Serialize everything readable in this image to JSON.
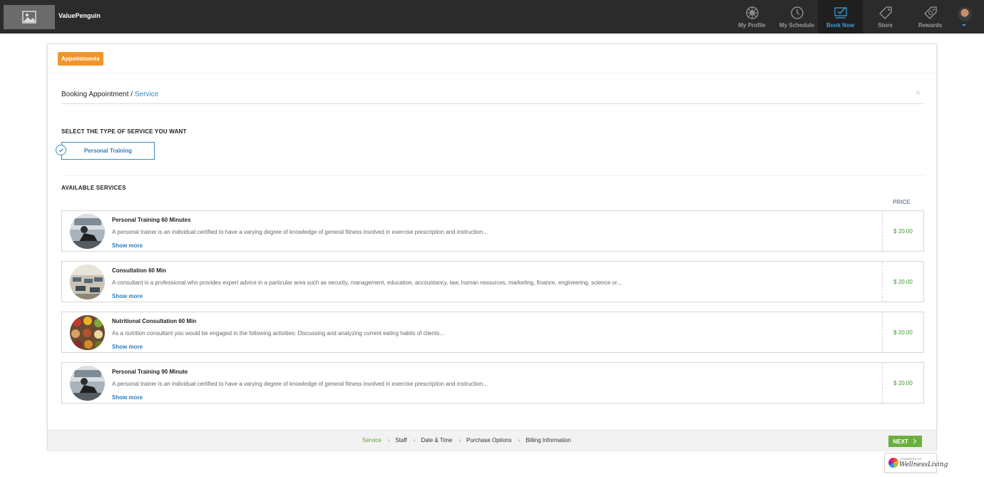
{
  "header": {
    "brand": "ValuePenguin",
    "nav": [
      {
        "label": "My Profile",
        "icon": "dharma-wheel-icon",
        "active": false
      },
      {
        "label": "My Schedule",
        "icon": "clock-icon",
        "active": false
      },
      {
        "label": "Book Now",
        "icon": "book-now-icon",
        "active": true
      },
      {
        "label": "Store",
        "icon": "tag-icon",
        "active": false
      },
      {
        "label": "Rewards",
        "icon": "reward-tag-icon",
        "active": false
      }
    ]
  },
  "card": {
    "tab": "Appointments",
    "breadcrumb": {
      "root": "Booking Appointment",
      "separator": " / ",
      "current": "Service"
    },
    "close": "×",
    "service_type_title": "SELECT THE TYPE OF SERVICE YOU WANT",
    "service_type_selected": "Personal Training",
    "available_title": "AVAILABLE SERVICES",
    "price_header": "PRICE",
    "services": [
      {
        "name": "Personal Training 60 Minutes",
        "description": "A personal trainer is an individual certified to have a varying degree of knowledge of general fitness involved in exercise prescription and instruction...",
        "show_more": "Show more",
        "price": "$ 20.00",
        "thumb": "gym"
      },
      {
        "name": "Consultation 60 Min",
        "description": "A consultant is a professional who provides expert advice in a particular area such as security, management, education, accountancy, law, human resources, marketing, finance, engineering, science or...",
        "show_more": "Show more",
        "price": "$ 20.00",
        "thumb": "gym-floor"
      },
      {
        "name": "Nutritional Consultation 60 Min",
        "description": "As a nutrition consultant you would be engaged in the following activities: Discussing and analyzing current eating habits of clients...",
        "show_more": "Show more",
        "price": "$ 20.00",
        "thumb": "food"
      },
      {
        "name": "Personal Training 90 Minute",
        "description": "A personal trainer is an individual certified to have a varying degree of knowledge of general fitness involved in exercise prescription and instruction...",
        "show_more": "Show more",
        "price": "$ 20.00",
        "thumb": "gym"
      }
    ],
    "steps": [
      "Service",
      "Staff",
      "Date & Time",
      "Purchase Options",
      "Billing Information"
    ],
    "active_step": "Service",
    "next": "NEXT"
  },
  "powered_by": {
    "small": "POWERED BY",
    "name": "WellnessLiving"
  },
  "colors": {
    "accent": "#3b9dd8",
    "tab": "#f0952a",
    "price": "#3b9a2f",
    "next": "#6ab040"
  }
}
